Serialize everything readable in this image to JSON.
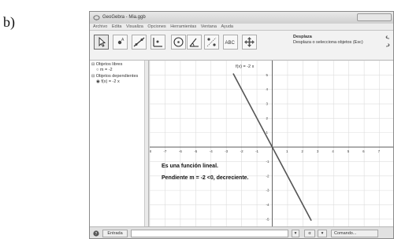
{
  "figure_label": "b)",
  "window": {
    "title": "GeoGebra - Mia.ggb"
  },
  "menu": [
    "Archivo",
    "Edita",
    "Visualiza",
    "Opciones",
    "Herramientas",
    "Ventana",
    "Ayuda"
  ],
  "toolbar": {
    "tools": [
      {
        "icon": "move-arrow-icon",
        "active": true
      },
      {
        "icon": "point-icon"
      },
      {
        "icon": "line-icon"
      },
      {
        "icon": "perpendicular-icon"
      },
      {
        "icon": "circle-icon"
      },
      {
        "icon": "angle-icon"
      },
      {
        "icon": "reflect-icon"
      },
      {
        "icon": "text-abc-icon",
        "label": "ABC"
      },
      {
        "icon": "move-view-icon"
      }
    ],
    "active_tool_name": "Desplaza",
    "active_tool_hint": "Desplaza o selecciona objetos (Esc)"
  },
  "algebra": {
    "free_header": "Objetos libres",
    "free_item": "m = -2",
    "dependent_header": "Objetos dependientes",
    "dependent_item": "f(x) = -2 x"
  },
  "graphics": {
    "function_label": "f(x) = -2 x",
    "annotation_line1": "Es una función lineal.",
    "annotation_line2": "Pendiente m = -2 <0, decreciente.",
    "line_color": "#555555",
    "axis_color": "#444444",
    "grid_color": "#dddddd"
  },
  "chart_data": {
    "type": "line",
    "series": [
      {
        "x": [
          -2.55,
          2.55
        ],
        "y": [
          5.1,
          -5.1
        ]
      }
    ],
    "xlim": [
      -8,
      8
    ],
    "ylim": [
      -5.5,
      6
    ],
    "x_ticks": [
      "-8",
      "-7",
      "-6",
      "-5",
      "-4",
      "-3",
      "-2",
      "-1",
      "1",
      "2",
      "3",
      "4",
      "5",
      "6",
      "7"
    ],
    "y_ticks": [
      "-5",
      "-4",
      "-3",
      "-2",
      "-1",
      "1",
      "2",
      "3",
      "4",
      "5"
    ],
    "grid": true
  },
  "inputbar": {
    "help": "?",
    "entrada_label": "Entrada",
    "symbol_btn": "α",
    "command_label": "Comando..."
  }
}
